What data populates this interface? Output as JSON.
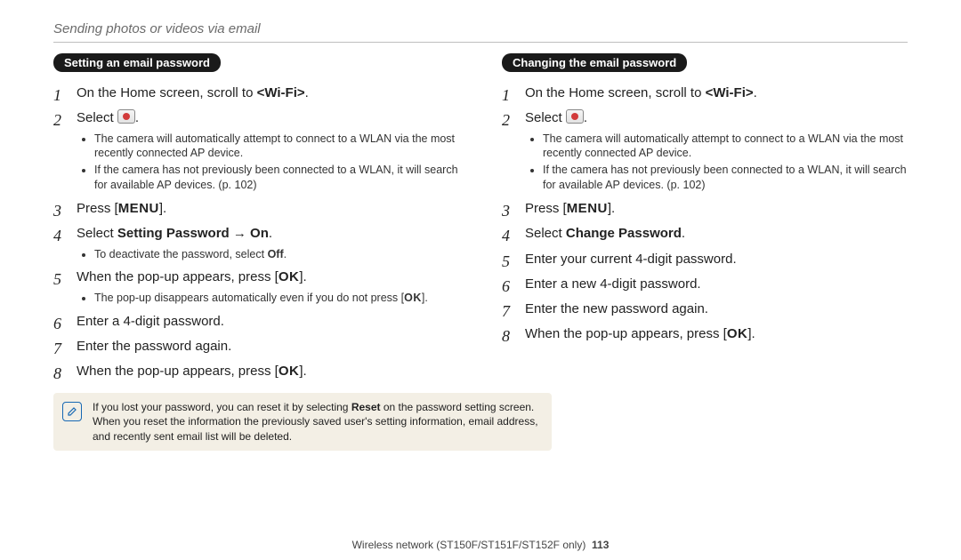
{
  "header": {
    "title": "Sending photos or videos via email"
  },
  "left": {
    "pill": "Setting an email password",
    "step1_pre": "On the Home screen, scroll to ",
    "step1_bold": "<Wi-Fi>",
    "step1_post": ".",
    "step2": "Select ",
    "sub2a": "The camera will automatically attempt to connect to a WLAN via the most recently connected AP device.",
    "sub2b": "If the camera has not previously been connected to a WLAN, it will search for available AP devices. (p. 102)",
    "step3_pre": "Press [",
    "step3_glyph": "MENU",
    "step3_post": "].",
    "step4_pre": "Select ",
    "step4_bold": "Setting Password → On",
    "step4_post": ".",
    "sub4a_pre": "To deactivate the password, select ",
    "sub4a_bold": "Off",
    "sub4a_post": ".",
    "step5_pre": "When the pop-up appears, press [",
    "step5_glyph": "OK",
    "step5_post": "].",
    "sub5a_pre": "The pop-up disappears automatically even if you do not press [",
    "sub5a_glyph": "OK",
    "sub5a_post": "].",
    "step6": "Enter a 4-digit password.",
    "step7": "Enter the password again.",
    "step8_pre": "When the pop-up appears, press [",
    "step8_glyph": "OK",
    "step8_post": "]."
  },
  "right": {
    "pill": "Changing the email password",
    "step1_pre": "On the Home screen, scroll to ",
    "step1_bold": "<Wi-Fi>",
    "step1_post": ".",
    "step2": "Select ",
    "sub2a": "The camera will automatically attempt to connect to a WLAN via the most recently connected AP device.",
    "sub2b": "If the camera has not previously been connected to a WLAN, it will search for available AP devices. (p. 102)",
    "step3_pre": "Press [",
    "step3_glyph": "MENU",
    "step3_post": "].",
    "step4_pre": "Select ",
    "step4_bold": "Change Password",
    "step4_post": ".",
    "step5": "Enter your current 4-digit password.",
    "step6": "Enter a new 4-digit password.",
    "step7": "Enter the new password again.",
    "step8_pre": "When the pop-up appears, press [",
    "step8_glyph": "OK",
    "step8_post": "]."
  },
  "note": {
    "line_pre": "If you lost your password, you can reset it by selecting ",
    "line_bold": "Reset",
    "line_post": " on the password setting screen. When you reset the information the previously saved user's setting information, email address, and recently sent email list will be deleted."
  },
  "footer": {
    "text": "Wireless network  (ST150F/ST151F/ST152F only)",
    "page": "113"
  }
}
